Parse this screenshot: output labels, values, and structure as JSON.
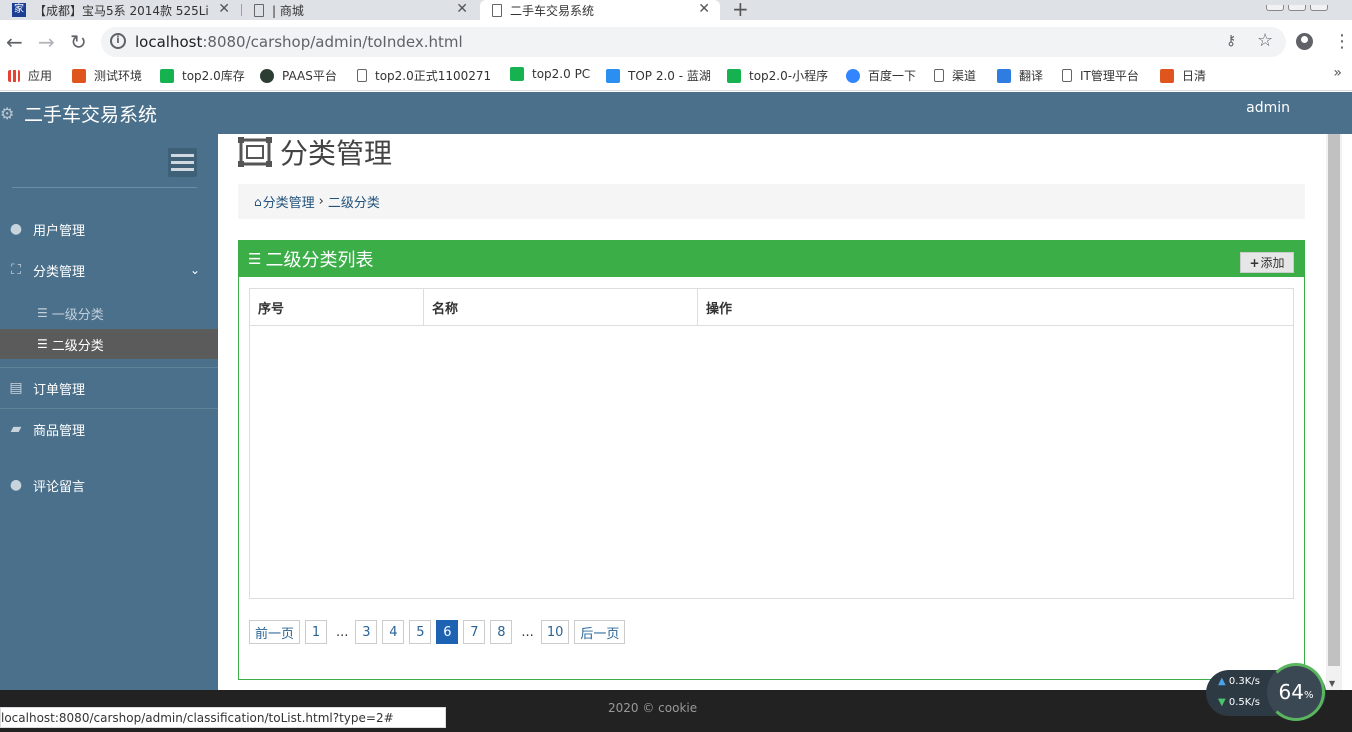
{
  "browser": {
    "tabs": [
      {
        "title": "【成都】宝马5系 2014款 525Li"
      },
      {
        "title": "| 商城"
      },
      {
        "title": "二手车交易系统"
      }
    ],
    "url_host": "localhost",
    "url_path": ":8080/carshop/admin/toIndex.html",
    "bookmarks": [
      "应用",
      "测试环境",
      "top2.0库存",
      "PAAS平台",
      "top2.0正式1100271",
      "top2.0 PC",
      "TOP 2.0 - 蓝湖",
      "top2.0-小程序",
      "百度一下",
      "渠道",
      "翻译",
      "IT管理平台",
      "日清"
    ],
    "status_url": "localhost:8080/carshop/admin/classification/toList.html?type=2#"
  },
  "header": {
    "brand": "二手车交易系统",
    "user": "admin"
  },
  "sidebar": {
    "items": [
      {
        "label": "用户管理"
      },
      {
        "label": "分类管理"
      },
      {
        "label": "订单管理"
      },
      {
        "label": "商品管理"
      },
      {
        "label": "评论留言"
      }
    ],
    "subitems": [
      {
        "label": "一级分类"
      },
      {
        "label": "二级分类"
      }
    ]
  },
  "main": {
    "title": "分类管理",
    "breadcrumb": [
      "分类管理",
      "二级分类"
    ],
    "panel_title": "二级分类列表",
    "add_label": "添加",
    "columns": [
      "序号",
      "名称",
      "操作"
    ],
    "pagination": {
      "prev": "前一页",
      "next": "后一页",
      "pages": [
        "1",
        "3",
        "4",
        "5",
        "6",
        "7",
        "8",
        "10"
      ],
      "ellipsis": "...",
      "current": "6"
    }
  },
  "footer": {
    "text": "2020 © cookie"
  },
  "netwidget": {
    "up": "0.3",
    "down": "0.5",
    "unit": "K/s",
    "percent": "64",
    "percent_unit": "%"
  },
  "colors": {
    "header": "#4a708b",
    "panel": "#3cae48",
    "active_page": "#1e62b4"
  }
}
